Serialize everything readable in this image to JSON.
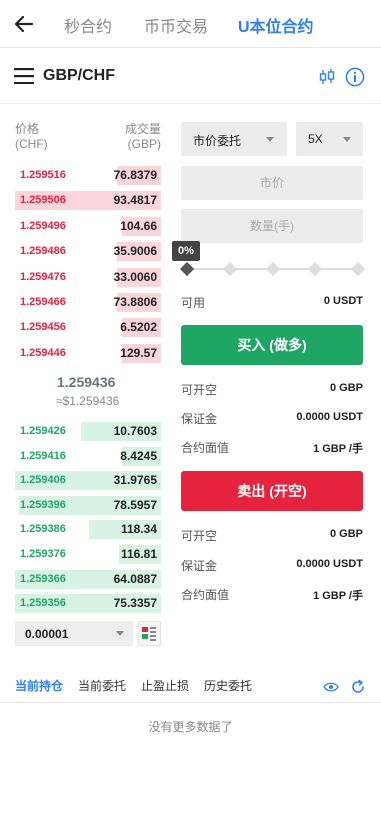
{
  "nav": {
    "tabs": [
      {
        "label": "秒合约"
      },
      {
        "label": "币币交易"
      },
      {
        "label": "U本位合约"
      }
    ]
  },
  "pair": {
    "title": "GBP/CHF"
  },
  "orderbook": {
    "price_header": "价格\n(CHF)",
    "price_header_line1": "价格",
    "price_header_line2": "(CHF)",
    "volume_header_line1": "成交量",
    "volume_header_line2": "(GBP)",
    "asks": [
      {
        "price": "1.259516",
        "volume": "76.8379",
        "depth": 0.3
      },
      {
        "price": "1.259506",
        "volume": "93.4817",
        "depth": 1.0
      },
      {
        "price": "1.259496",
        "volume": "104.66",
        "depth": 0.27
      },
      {
        "price": "1.259486",
        "volume": "35.9006",
        "depth": 0.3
      },
      {
        "price": "1.259476",
        "volume": "33.0060",
        "depth": 0.3
      },
      {
        "price": "1.259466",
        "volume": "73.8806",
        "depth": 0.3
      },
      {
        "price": "1.259456",
        "volume": "6.5202",
        "depth": 0.27
      },
      {
        "price": "1.259446",
        "volume": "129.57",
        "depth": 0.27
      }
    ],
    "mid_price": "1.259436",
    "mid_usd": "≈$1.259436",
    "bids": [
      {
        "price": "1.259426",
        "volume": "10.7603",
        "depth": 0.55
      },
      {
        "price": "1.259416",
        "volume": "8.4245",
        "depth": 0.27
      },
      {
        "price": "1.259406",
        "volume": "31.9765",
        "depth": 1.0
      },
      {
        "price": "1.259396",
        "volume": "78.5957",
        "depth": 0.97
      },
      {
        "price": "1.259386",
        "volume": "118.34",
        "depth": 0.49
      },
      {
        "price": "1.259376",
        "volume": "116.81",
        "depth": 0.29
      },
      {
        "price": "1.259366",
        "volume": "64.0887",
        "depth": 1.0
      },
      {
        "price": "1.259356",
        "volume": "75.3357",
        "depth": 1.0
      }
    ],
    "precision": "0.00001"
  },
  "order_form": {
    "order_type": "市价委托",
    "leverage": "5X",
    "price_placeholder": "市价",
    "quantity_placeholder": "数量(手)",
    "percent": "0%",
    "available_label": "可用",
    "available_value": "0 USDT",
    "buy_label": "买入 (做多)",
    "buy_info": [
      {
        "label": "可开空",
        "value": "0 GBP"
      },
      {
        "label": "保证金",
        "value": "0.0000 USDT"
      },
      {
        "label": "合约面值",
        "value": "1 GBP /手"
      }
    ],
    "sell_label": "卖出 (开空)",
    "sell_info": [
      {
        "label": "可开空",
        "value": "0 GBP"
      },
      {
        "label": "保证金",
        "value": "0.0000 USDT"
      },
      {
        "label": "合约面值",
        "value": "1 GBP /手"
      }
    ]
  },
  "bottom_tabs": [
    {
      "label": "当前持仓"
    },
    {
      "label": "当前委托"
    },
    {
      "label": "止盈止损"
    },
    {
      "label": "历史委托"
    }
  ],
  "empty_text": "没有更多数据了",
  "colors": {
    "accent": "#2f7ff0",
    "buy": "#1fa665",
    "sell": "#e5233f"
  }
}
